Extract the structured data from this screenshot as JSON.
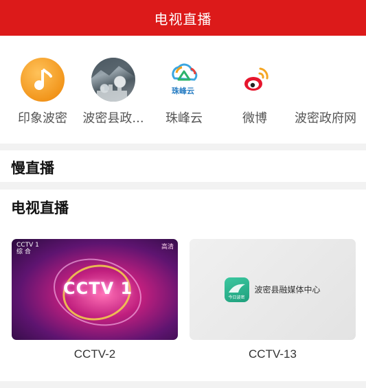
{
  "header": {
    "title": "电视直播"
  },
  "quick_links": [
    {
      "label": "印象波密",
      "icon": "music-note-icon"
    },
    {
      "label": "波密县政...",
      "icon": "city-photo-icon"
    },
    {
      "label": "珠峰云",
      "icon": "zhufeng-cloud-icon",
      "icon_text": "珠峰云"
    },
    {
      "label": "微博",
      "icon": "weibo-icon"
    },
    {
      "label": "波密政府网",
      "icon": "government-site-icon"
    }
  ],
  "sections": {
    "slow_live": "慢直播",
    "tv_live": "电视直播"
  },
  "channels": [
    {
      "name": "CCTV-2",
      "thumb_logo": "CCTV 1",
      "corner_text": "CCTV 1",
      "corner_sub": "综 合",
      "corner_right": "高清"
    },
    {
      "name": "CCTV-13",
      "thumb_text": "波密县融媒体中心",
      "thumb_logo_sub": "今日波密"
    }
  ],
  "colors": {
    "header_bg": "#dc1a1a",
    "divider": "#f2f2f2"
  }
}
